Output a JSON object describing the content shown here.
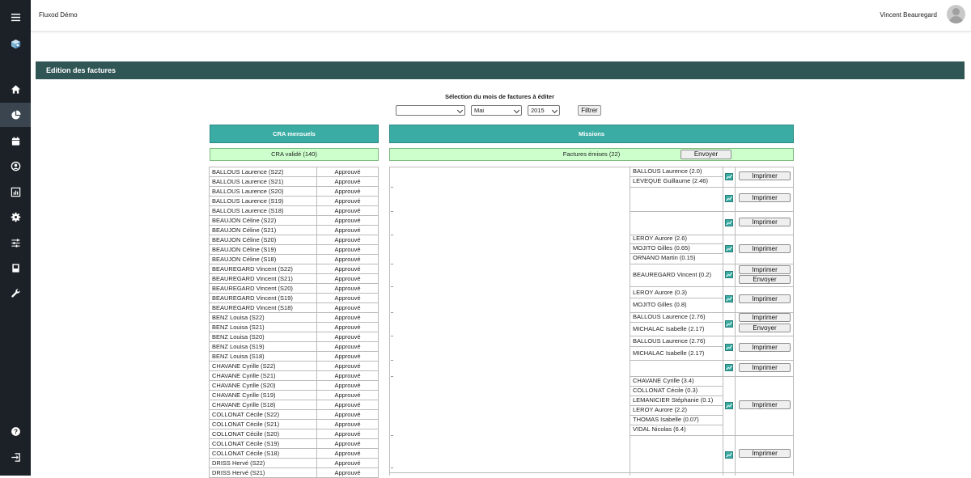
{
  "header": {
    "app_title": "Fluxod Démo",
    "user_name": "Vincent Beauregard"
  },
  "sidebar": {
    "icons": [
      "menu-icon",
      "cube-logo-icon",
      "home-icon",
      "pie-chart-icon",
      "calendar-icon",
      "user-circle-icon",
      "bar-chart-icon",
      "gear-icon",
      "sliders-icon",
      "book-icon",
      "wrench-icon",
      "help-icon",
      "logout-icon"
    ]
  },
  "page": {
    "title": "Edition des factures"
  },
  "filter": {
    "title": "Sélection du mois de factures à éditer",
    "select1": "",
    "month": "Mai",
    "year": "2015",
    "button": "Filtrer"
  },
  "cra": {
    "header": "CRA mensuels",
    "summary": "CRA validé (140)",
    "rows": [
      [
        "BALLOUS Laurence (S22)",
        "Approuvé"
      ],
      [
        "BALLOUS Laurence (S21)",
        "Approuvé"
      ],
      [
        "BALLOUS Laurence (S20)",
        "Approuvé"
      ],
      [
        "BALLOUS Laurence (S19)",
        "Approuvé"
      ],
      [
        "BALLOUS Laurence (S18)",
        "Approuvé"
      ],
      [
        "BEAUJON Céline (S22)",
        "Approuvé"
      ],
      [
        "BEAUJON Céline (S21)",
        "Approuvé"
      ],
      [
        "BEAUJON Céline (S20)",
        "Approuvé"
      ],
      [
        "BEAUJON Céline (S19)",
        "Approuvé"
      ],
      [
        "BEAUJON Céline (S18)",
        "Approuvé"
      ],
      [
        "BEAUREGARD Vincent (S22)",
        "Approuvé"
      ],
      [
        "BEAUREGARD Vincent (S21)",
        "Approuvé"
      ],
      [
        "BEAUREGARD Vincent (S20)",
        "Approuvé"
      ],
      [
        "BEAUREGARD Vincent (S19)",
        "Approuvé"
      ],
      [
        "BEAUREGARD Vincent (S18)",
        "Approuvé"
      ],
      [
        "BENZ Louisa (S22)",
        "Approuvé"
      ],
      [
        "BENZ Louisa (S21)",
        "Approuvé"
      ],
      [
        "BENZ Louisa (S20)",
        "Approuvé"
      ],
      [
        "BENZ Louisa (S19)",
        "Approuvé"
      ],
      [
        "BENZ Louisa (S18)",
        "Approuvé"
      ],
      [
        "CHAVANE Cyrille (S22)",
        "Approuvé"
      ],
      [
        "CHAVANE Cyrille (S21)",
        "Approuvé"
      ],
      [
        "CHAVANE Cyrille (S20)",
        "Approuvé"
      ],
      [
        "CHAVANE Cyrille (S19)",
        "Approuvé"
      ],
      [
        "CHAVANE Cyrille (S18)",
        "Approuvé"
      ],
      [
        "COLLONAT Cécile (S22)",
        "Approuvé"
      ],
      [
        "COLLONAT Cécile (S21)",
        "Approuvé"
      ],
      [
        "COLLONAT Cécile (S20)",
        "Approuvé"
      ],
      [
        "COLLONAT Cécile (S19)",
        "Approuvé"
      ],
      [
        "COLLONAT Cécile (S18)",
        "Approuvé"
      ],
      [
        "DRISS Hervé (S22)",
        "Approuvé"
      ],
      [
        "DRISS Hervé (S21)",
        "Approuvé"
      ]
    ]
  },
  "missions": {
    "header": "Missions",
    "summary": "Factures émises (22)",
    "send_all": "Envoyer",
    "groups": [
      {
        "names": [
          "BALLOUS Laurence (2.0)",
          "LEVEQUE Guillaume (2.46)"
        ],
        "buttons": [
          "Imprimer"
        ]
      },
      {
        "names": [],
        "buttons": [
          "Imprimer"
        ]
      },
      {
        "names": [],
        "buttons": [
          "Imprimer"
        ]
      },
      {
        "names": [
          "LEROY Aurore (2.6)",
          "MOJITO Gilles (0.65)",
          "ORNANO Martin (0.15)"
        ],
        "buttons": [
          "Imprimer"
        ]
      },
      {
        "names": [
          "BEAUREGARD Vincent (0.2)"
        ],
        "buttons": [
          "Imprimer",
          "Envoyer"
        ]
      },
      {
        "names": [
          "LEROY Aurore (0.3)",
          "MOJITO Gilles (0.8)"
        ],
        "buttons": [
          "Imprimer"
        ]
      },
      {
        "names": [
          "BALLOUS Laurence (2.76)",
          "MICHALAC Isabelle (2.17)"
        ],
        "buttons": [
          "Imprimer",
          "Envoyer"
        ]
      },
      {
        "names": [
          "BALLOUS Laurence (2.76)",
          "MICHALAC Isabelle (2.17)"
        ],
        "buttons": [
          "Imprimer"
        ]
      },
      {
        "names": [],
        "buttons": [
          "Imprimer"
        ]
      },
      {
        "names": [
          "CHAVANE Cyrille (3.4)",
          "COLLONAT Cécile (0.3)",
          "LEMANICIER Stéphanie (0.1)",
          "LEROY Aurore (2.2)",
          "THOMAS Isabelle (0.07)",
          "VIDAL Nicolas (6.4)"
        ],
        "buttons": [
          "Imprimer"
        ]
      },
      {
        "names": [],
        "buttons": [
          "Imprimer"
        ]
      }
    ]
  }
}
